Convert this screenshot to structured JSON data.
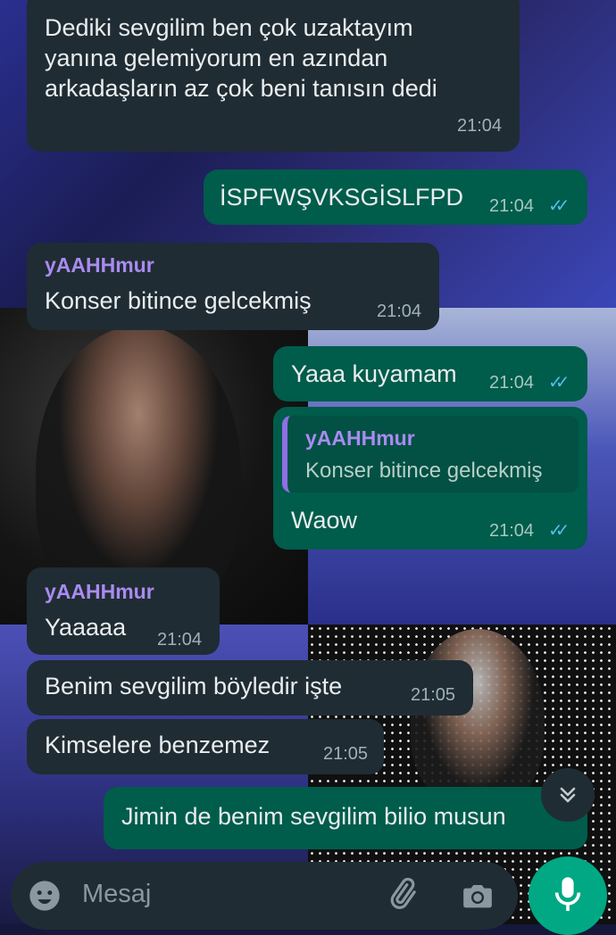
{
  "messages": [
    {
      "dir": "in",
      "text": "Dediki sevgilim ben çok uzaktayım\nyanına gelemiyorum en azından\narkadaşların az çok beni tanısın dedi",
      "time": "21:04"
    },
    {
      "dir": "out",
      "text": "İSPFWŞVKSGİSLFPD",
      "time": "21:04"
    },
    {
      "dir": "in",
      "sender": "yAAHHmur",
      "text": "Konser bitince gelcekmiş",
      "time": "21:04"
    },
    {
      "dir": "out",
      "text": "Yaaa kuyamam",
      "time": "21:04"
    },
    {
      "dir": "out",
      "quote_sender": "yAAHHmur",
      "quote_text": "Konser bitince gelcekmiş",
      "text": "Waow",
      "time": "21:04"
    },
    {
      "dir": "in",
      "sender": "yAAHHmur",
      "text": "Yaaaaa",
      "time": "21:04"
    },
    {
      "dir": "in",
      "text": "Benim sevgilim böyledir işte",
      "time": "21:05"
    },
    {
      "dir": "in",
      "text": "Kimselere benzemez",
      "time": "21:05"
    },
    {
      "dir": "out",
      "text": "Jimin de benim sevgilim bilio musun"
    }
  ],
  "input": {
    "placeholder": "Mesaj"
  },
  "icons": {
    "emoji": "emoji-icon",
    "attach": "paperclip-icon",
    "camera": "camera-icon",
    "mic": "microphone-icon",
    "scroll": "chevron-double-down-icon",
    "read": "double-check-icon"
  },
  "colors": {
    "incoming": "#202c33",
    "outgoing": "#005c4b",
    "accent": "#00a884",
    "sender": "#a98bf1",
    "read_ticks": "#53bdeb"
  }
}
